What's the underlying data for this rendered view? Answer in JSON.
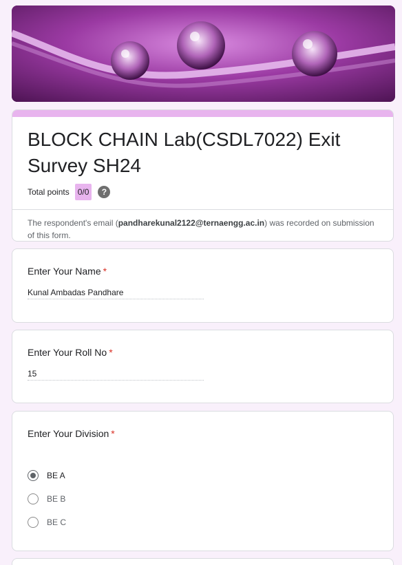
{
  "form": {
    "title": "BLOCK CHAIN Lab(CSDL7022) Exit Survey SH24",
    "points_label": "Total points",
    "points_value": "0/0",
    "email_prefix": "The respondent's email (",
    "email": "pandharekunal2122@ternaengg.ac.in",
    "email_suffix": ") was recorded on submission of this form."
  },
  "questions": [
    {
      "title": "Enter Your Name",
      "required": "*",
      "answer": "Kunal Ambadas Pandhare"
    },
    {
      "title": "Enter Your Roll No",
      "required": "*",
      "answer": "15"
    },
    {
      "title": "Enter Your Division",
      "required": "*",
      "options": [
        {
          "label": "BE A",
          "selected": true
        },
        {
          "label": "BE B",
          "selected": false
        },
        {
          "label": "BE C",
          "selected": false
        }
      ]
    }
  ],
  "colors": {
    "accent": "#e8b4ee",
    "background": "#f9f0fb",
    "required": "#d93025"
  },
  "icons": {
    "help": "question-mark-icon"
  }
}
